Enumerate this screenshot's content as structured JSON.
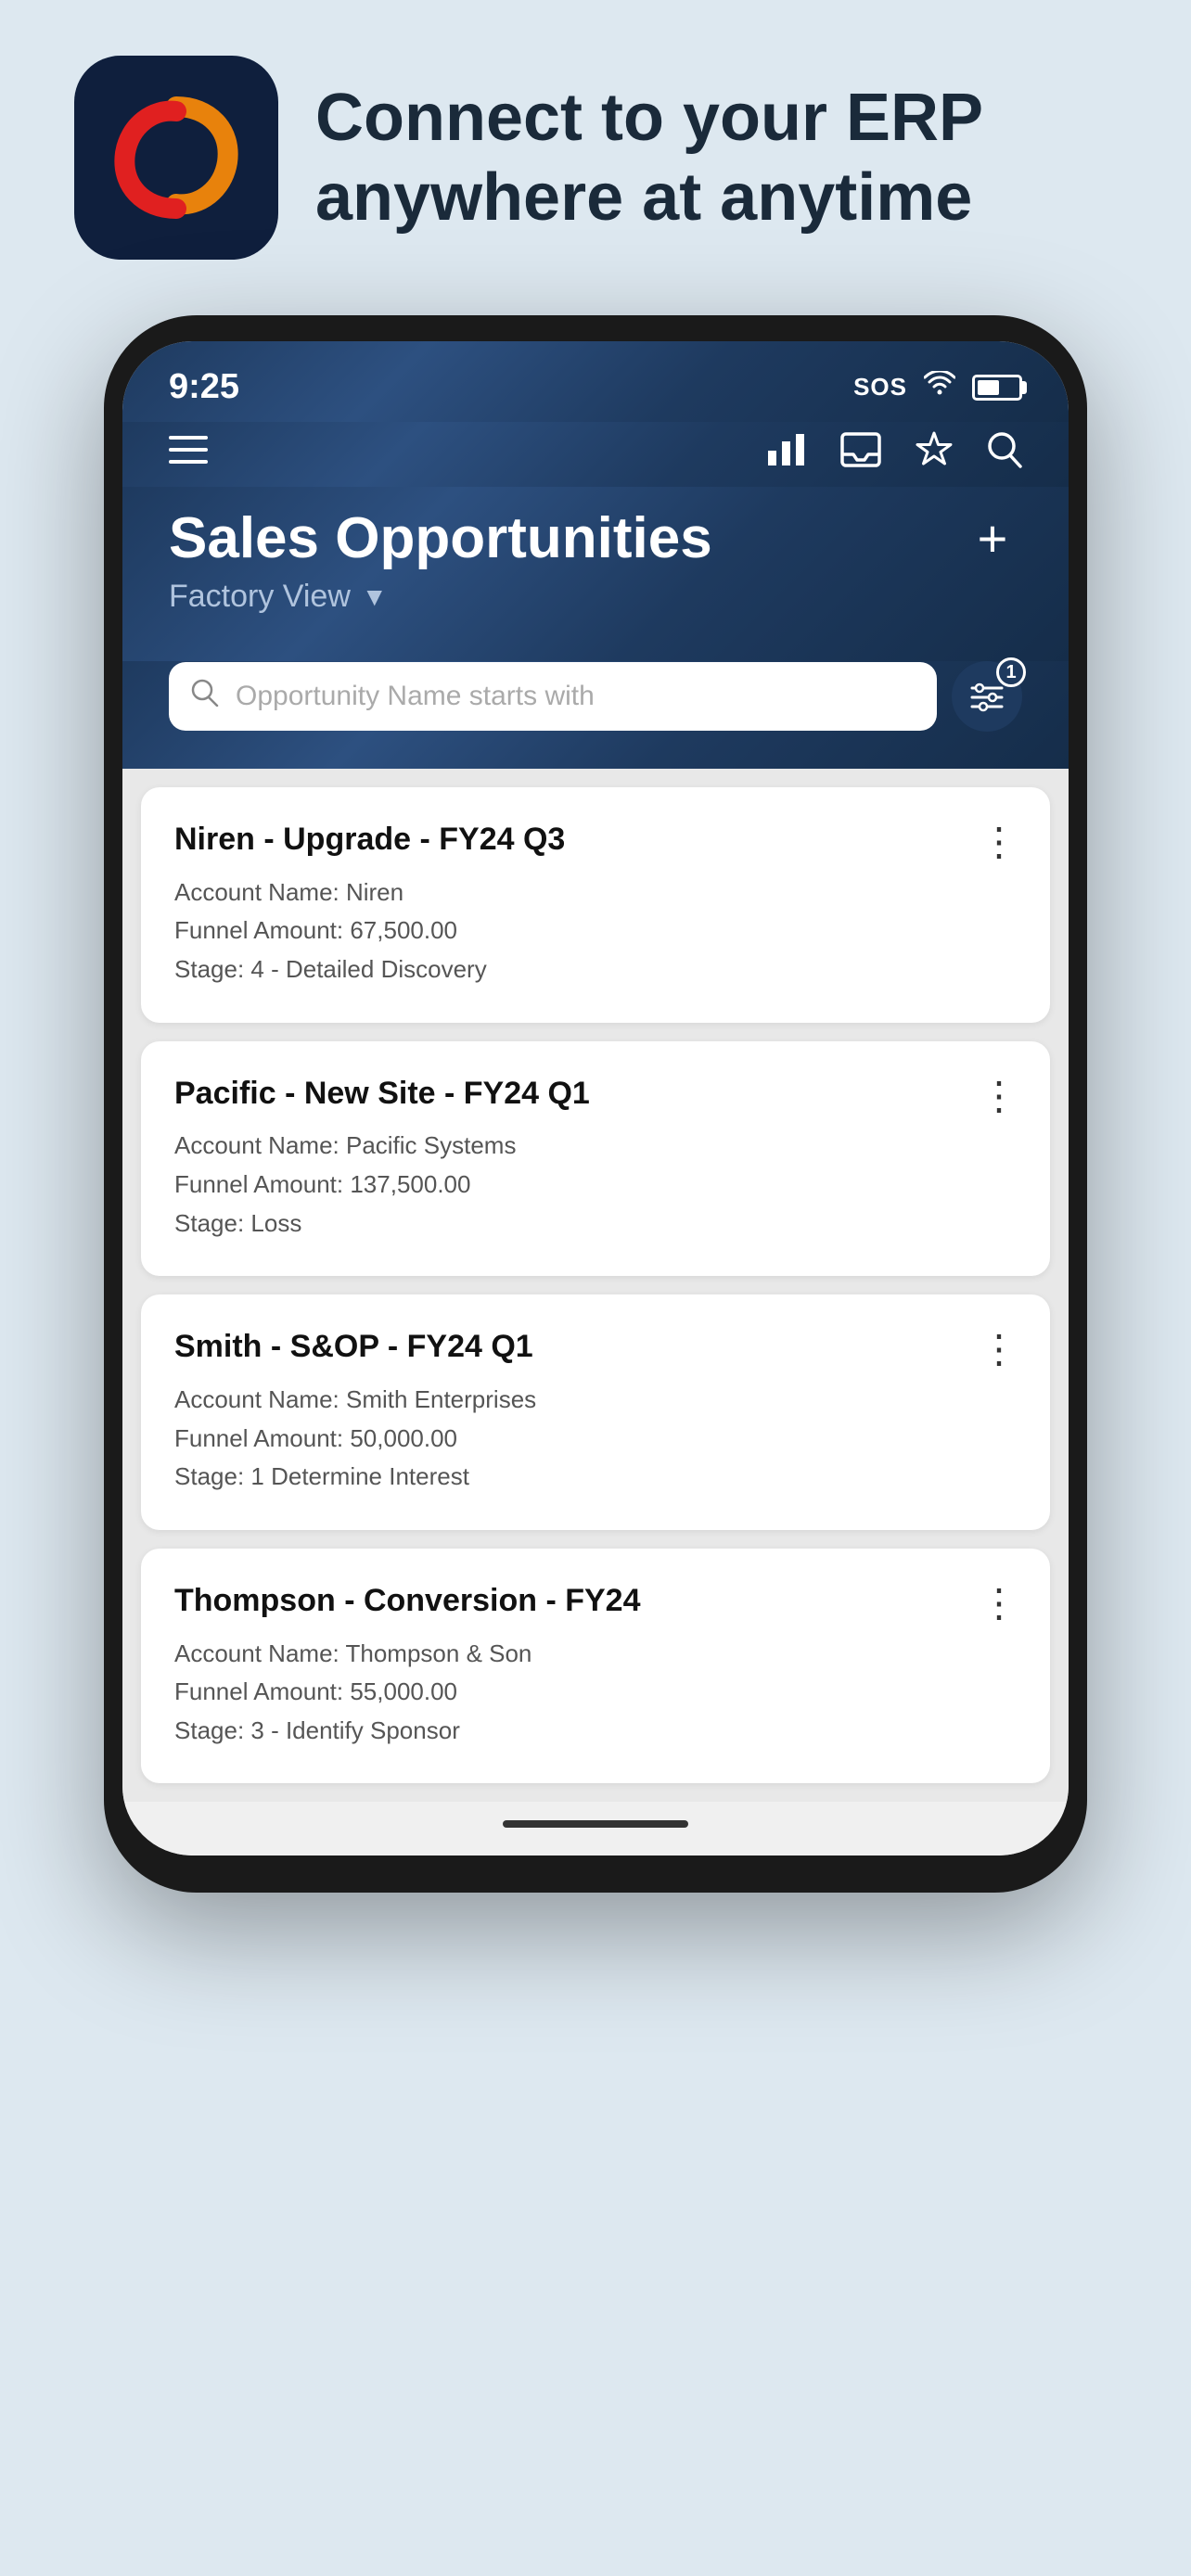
{
  "header": {
    "tagline": "Connect to your ERP anywhere at anytime"
  },
  "statusBar": {
    "time": "9:25",
    "sos": "SOS",
    "batteryLevel": 55
  },
  "navIcons": {
    "chart": "chart-icon",
    "inbox": "inbox-icon",
    "star": "star-icon",
    "search": "search-icon"
  },
  "page": {
    "title": "Sales Opportunities",
    "addButton": "+",
    "viewLabel": "Factory View",
    "viewArrow": "▼"
  },
  "search": {
    "placeholder": "Opportunity Name starts with",
    "filterBadge": "1"
  },
  "opportunities": [
    {
      "title": "Niren - Upgrade - FY24 Q3",
      "accountName": "Account Name: Niren",
      "funnelAmount": "Funnel Amount: 67,500.00",
      "stage": "Stage: 4 - Detailed Discovery"
    },
    {
      "title": "Pacific - New Site - FY24 Q1",
      "accountName": "Account Name: Pacific Systems",
      "funnelAmount": "Funnel Amount: 137,500.00",
      "stage": "Stage: Loss"
    },
    {
      "title": "Smith - S&OP - FY24 Q1",
      "accountName": "Account Name: Smith Enterprises",
      "funnelAmount": "Funnel Amount: 50,000.00",
      "stage": "Stage: 1 Determine Interest"
    },
    {
      "title": "Thompson - Conversion - FY24",
      "accountName": "Account Name: Thompson & Son",
      "funnelAmount": "Funnel Amount: 55,000.00",
      "stage": "Stage: 3 - Identify Sponsor"
    }
  ]
}
